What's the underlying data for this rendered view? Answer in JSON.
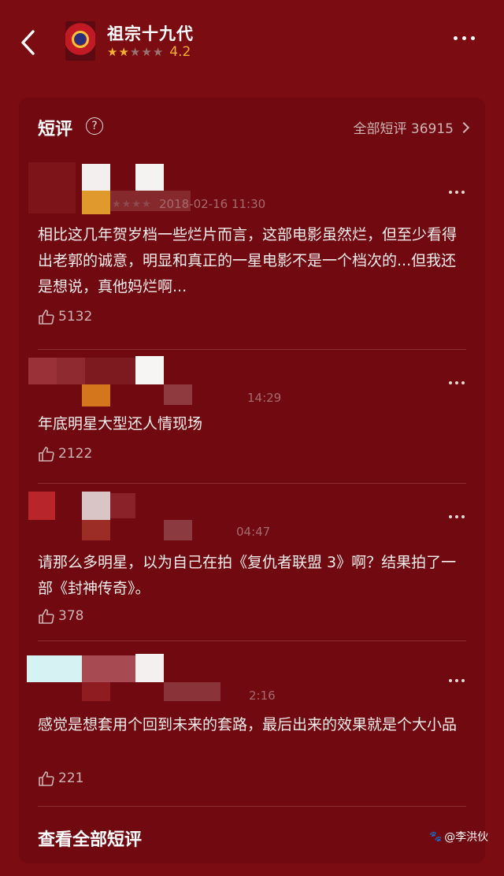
{
  "header": {
    "title": "祖宗十九代",
    "score": "4.2",
    "star_filled": 2,
    "star_total": 5
  },
  "section": {
    "title": "短评",
    "help_glyph": "?",
    "all_link": "全部短评 36915"
  },
  "reviews": [
    {
      "meta": "2018-02-16 11:30",
      "text": "相比这几年贺岁档一些烂片而言，这部电影虽然烂，但至少看得出老郭的诚意，明显和真正的一星电影不是一个档次的...但我还是想说，真他妈烂啊...",
      "likes": "5132"
    },
    {
      "meta": "14:29",
      "text": "年底明星大型还人情现场",
      "likes": "2122"
    },
    {
      "meta": "04:47",
      "text": "请那么多明星，以为自己在拍《复仇者联盟 3》啊？结果拍了一部《封神传奇》。",
      "likes": "378"
    },
    {
      "meta": "2:16",
      "text": "感觉是想套用个回到未来的套路，最后出来的效果就是个大小品",
      "likes": "221"
    }
  ],
  "footer": {
    "view_all": "查看全部短评"
  },
  "watermark": "@李洪伙",
  "colors": {
    "background": "#7a0c12",
    "card": "#700a10",
    "star": "#f2b02d",
    "text": "#f5eded"
  }
}
